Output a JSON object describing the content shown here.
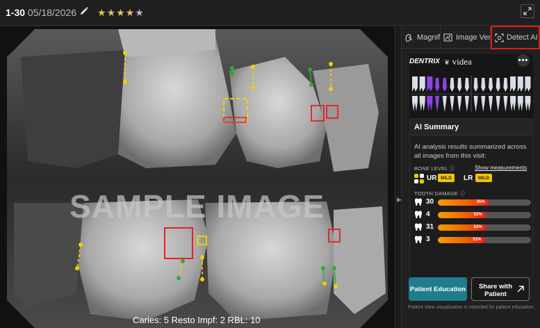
{
  "header": {
    "image_number": "1-30",
    "date": "05/18/2026",
    "rating_filled": 4,
    "rating_total": 5
  },
  "viewer": {
    "watermark": "SAMPLE IMAGE",
    "findings_summary": "Caries: 5 Resto Impf: 2 RBL: 10"
  },
  "tabs": [
    {
      "label": "Magnify",
      "icon": "magnify-icon"
    },
    {
      "label": "Image Verify",
      "icon": "image-verify-icon"
    },
    {
      "label": "Detect AI",
      "icon": "detect-ai-icon",
      "highlighted": true
    }
  ],
  "brand": {
    "dentrix": "DENTRIX",
    "videa": "videa",
    "more": "•••"
  },
  "summary": {
    "title": "AI Summary",
    "description": "AI analysis results summarized across all images from this visit:",
    "bone_level_label": "BONE LEVEL",
    "show_measurements": "Show measurements",
    "bone_levels": [
      {
        "side": "UR",
        "severity": "MILD"
      },
      {
        "side": "LR",
        "severity": "MILD"
      }
    ],
    "tooth_damage_label": "TOOTH DAMAGE",
    "tooth_damage": [
      {
        "tooth": "30",
        "percent": 55,
        "label": "55%"
      },
      {
        "tooth": "4",
        "percent": 52,
        "label": "52%"
      },
      {
        "tooth": "31",
        "percent": 52,
        "label": "52%"
      },
      {
        "tooth": "3",
        "percent": 51,
        "label": "51%"
      }
    ]
  },
  "buttons": {
    "patient_education": "Patient Education",
    "share_with_patient": "Share with Patient"
  },
  "footnote": "Patient View visualization is intended for patient education.",
  "colors": {
    "accent_teal": "#1e7d8c",
    "highlight_red": "#e01b1b",
    "mild_yellow": "#f2c500",
    "star_gold": "#e0c269",
    "tooth_purple": "#8b44e8"
  }
}
